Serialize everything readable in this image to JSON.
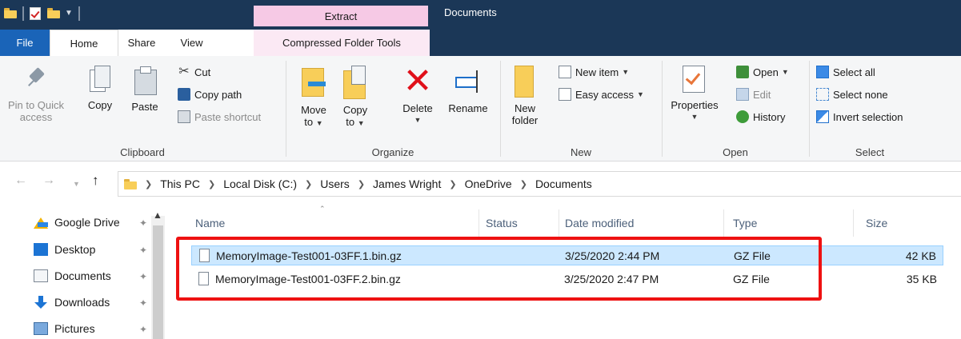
{
  "titlebar": {
    "context_tab": "Extract",
    "window_title": "Documents"
  },
  "ribbon_tabs": {
    "file": "File",
    "home": "Home",
    "share": "Share",
    "view": "View",
    "compressed_folder_tools": "Compressed Folder Tools"
  },
  "ribbon": {
    "clipboard": {
      "label": "Clipboard",
      "pin_line1": "Pin to Quick",
      "pin_line2": "access",
      "copy": "Copy",
      "paste": "Paste",
      "cut": "Cut",
      "copy_path": "Copy path",
      "paste_shortcut": "Paste shortcut"
    },
    "organize": {
      "label": "Organize",
      "move_to_line1": "Move",
      "move_to_line2": "to",
      "copy_to_line1": "Copy",
      "copy_to_line2": "to",
      "delete": "Delete",
      "rename": "Rename"
    },
    "new": {
      "label": "New",
      "new_folder_line1": "New",
      "new_folder_line2": "folder",
      "new_item": "New item",
      "easy_access": "Easy access"
    },
    "open": {
      "label": "Open",
      "properties": "Properties",
      "open": "Open",
      "edit": "Edit",
      "history": "History"
    },
    "select": {
      "label": "Select",
      "select_all": "Select all",
      "select_none": "Select none",
      "invert_selection": "Invert selection"
    }
  },
  "address": {
    "crumbs": [
      "This PC",
      "Local Disk (C:)",
      "Users",
      "James Wright",
      "OneDrive",
      "Documents"
    ]
  },
  "navpane": {
    "items": [
      {
        "label": "Google Drive",
        "icon": "google-drive-icon"
      },
      {
        "label": "Desktop",
        "icon": "desktop-icon"
      },
      {
        "label": "Documents",
        "icon": "documents-icon"
      },
      {
        "label": "Downloads",
        "icon": "downloads-icon"
      },
      {
        "label": "Pictures",
        "icon": "pictures-icon"
      }
    ]
  },
  "filelist": {
    "columns": {
      "name": "Name",
      "status": "Status",
      "date_modified": "Date modified",
      "type": "Type",
      "size": "Size"
    },
    "rows": [
      {
        "name": "MemoryImage-Test001-03FF.1.bin.gz",
        "status": "",
        "date_modified": "3/25/2020 2:44 PM",
        "type": "GZ File",
        "size": "42 KB",
        "selected": true
      },
      {
        "name": "MemoryImage-Test001-03FF.2.bin.gz",
        "status": "",
        "date_modified": "3/25/2020 2:47 PM",
        "type": "GZ File",
        "size": "35 KB",
        "selected": false
      }
    ]
  },
  "colors": {
    "titlebar": "#1b3757",
    "file_tab": "#1a64b8",
    "context_tab": "#f6c9e5",
    "selection": "#cce8ff",
    "highlight": "#ee1111"
  }
}
